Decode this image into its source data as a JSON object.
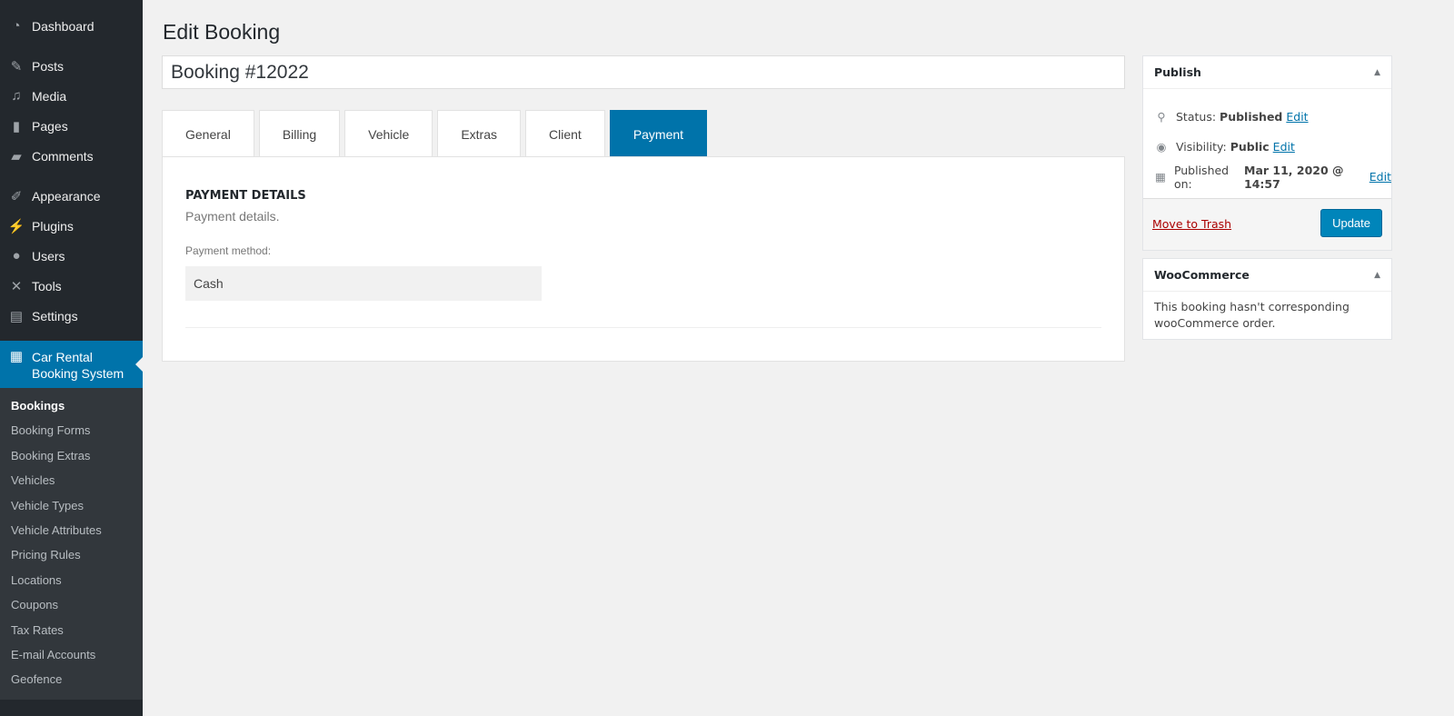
{
  "sidebar": {
    "menu": [
      "Dashboard",
      "Posts",
      "Media",
      "Pages",
      "Comments",
      "Appearance",
      "Plugins",
      "Users",
      "Tools",
      "Settings"
    ],
    "active": "Car Rental Booking System",
    "submenu": [
      "Bookings",
      "Booking Forms",
      "Booking Extras",
      "Vehicles",
      "Vehicle Types",
      "Vehicle Attributes",
      "Pricing Rules",
      "Locations",
      "Coupons",
      "Tax Rates",
      "E-mail Accounts",
      "Geofence"
    ]
  },
  "page_title": "Edit Booking",
  "post_title": "Booking #12022",
  "tabs": [
    "General",
    "Billing",
    "Vehicle",
    "Extras",
    "Client",
    "Payment"
  ],
  "panel": {
    "heading": "PAYMENT DETAILS",
    "description": "Payment details.",
    "method_label": "Payment method:",
    "method_value": "Cash"
  },
  "publish": {
    "title": "Publish",
    "status_label": "Status:",
    "status": "Published",
    "visibility_label": "Visibility:",
    "visibility": "Public",
    "published_label": "Published on:",
    "published": "Mar 11, 2020 @ 14:57",
    "edit": "Edit",
    "trash": "Move to Trash",
    "update": "Update"
  },
  "woocommerce": {
    "title": "WooCommerce",
    "text": "This booking hasn't corresponding wooCommerce order."
  }
}
